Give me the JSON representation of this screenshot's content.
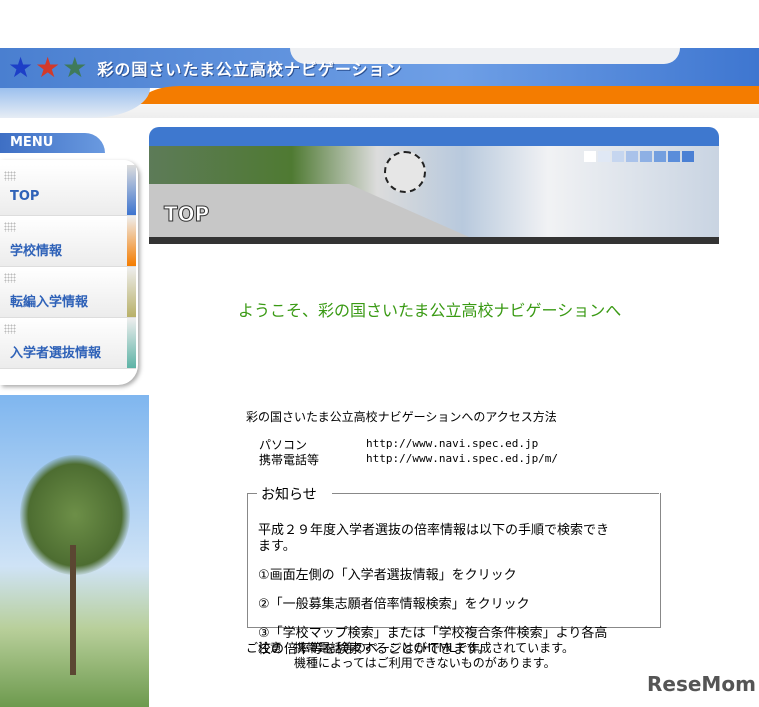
{
  "header": {
    "site_title": "彩の国さいたま公立高校ナビゲーション",
    "logo_icons": [
      "star-blue",
      "star-red",
      "star-green"
    ]
  },
  "menu": {
    "title": "MENU",
    "items": [
      {
        "label": "TOP",
        "color": "#3d74cf"
      },
      {
        "label": "学校情報",
        "color": "#f47c00"
      },
      {
        "label": "転編入学情報",
        "color": "#b8b068"
      },
      {
        "label": "入学者選抜情報",
        "color": "#5db3a6"
      }
    ]
  },
  "banner": {
    "title": "TOP"
  },
  "main": {
    "welcome": "ようこそ、彩の国さいたま公立高校ナビゲーションへ",
    "access_title": "彩の国さいたま公立高校ナビゲーションへのアクセス方法",
    "access": [
      {
        "label": "パソコン",
        "url": "http://www.navi.spec.ed.jp"
      },
      {
        "label": "携帯電話等",
        "url": "http://www.navi.spec.ed.jp/m/"
      }
    ],
    "notice": {
      "legend": "お知らせ",
      "lines": [
        "平成２９年度入学者選抜の倍率情報は以下の手順で検索でき",
        "ます。",
        "①画面左側の「入学者選抜情報」をクリック",
        "②「一般募集志願者倍率情報検索」をクリック",
        "③「学校マップ検索」または「学校複合条件検索」より各高",
        "校の倍率等を検索することができます。"
      ]
    },
    "caution": [
      "ご注意　携帯電話等のページはCHTMLで作成されています。",
      "機種によってはご利用できないものがあります。"
    ]
  },
  "watermark": "ReseMom"
}
